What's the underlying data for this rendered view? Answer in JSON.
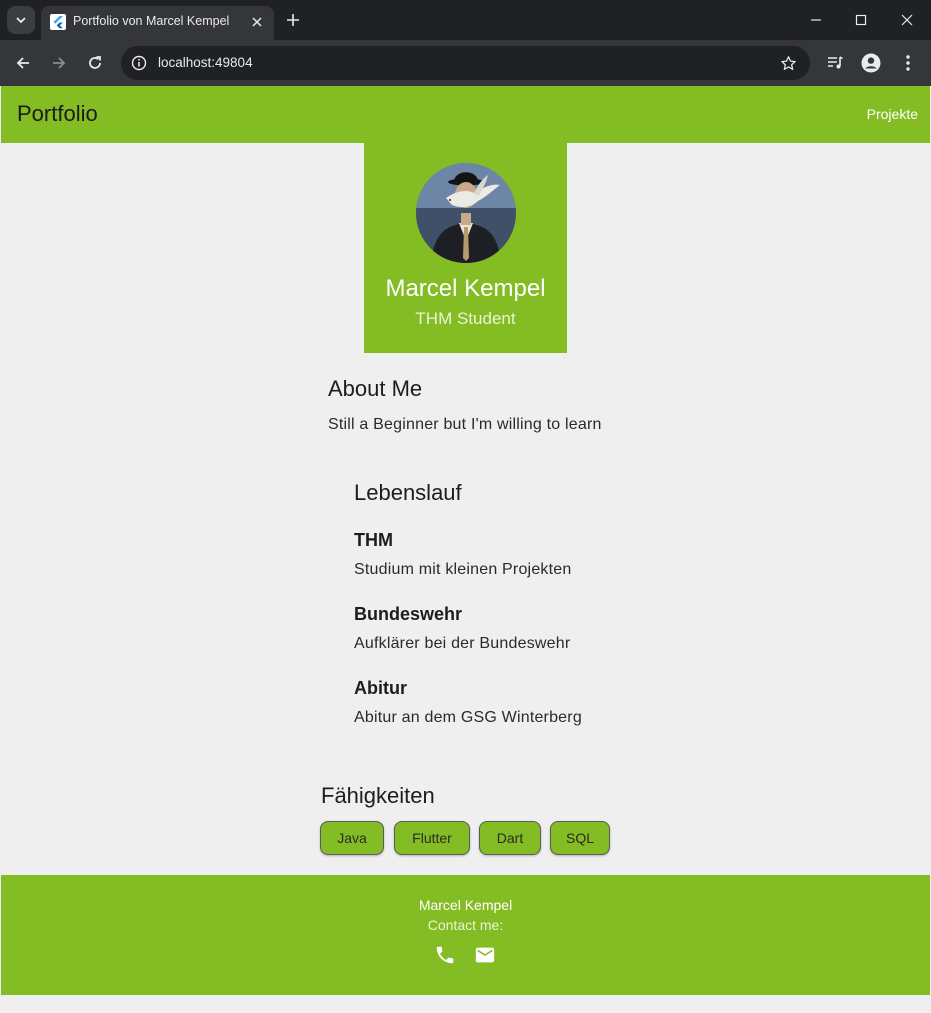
{
  "browser": {
    "tab_title": "Portfolio von Marcel Kempel",
    "url": "localhost:49804"
  },
  "appbar": {
    "title": "Portfolio",
    "nav_link": "Projekte"
  },
  "hero": {
    "name": "Marcel Kempel",
    "subtitle": "THM Student"
  },
  "about": {
    "title": "About Me",
    "text": "Still a Beginner but I'm willing to learn"
  },
  "cv": {
    "title": "Lebenslauf",
    "items": [
      {
        "title": "THM",
        "text": "Studium mit kleinen Projekten"
      },
      {
        "title": "Bundeswehr",
        "text": "Aufklärer bei der Bundeswehr"
      },
      {
        "title": "Abitur",
        "text": "Abitur an dem GSG Winterberg"
      }
    ]
  },
  "skills": {
    "title": "Fähigkeiten",
    "items": [
      "Java",
      "Flutter",
      "Dart",
      "SQL"
    ]
  },
  "footer": {
    "name": "Marcel Kempel",
    "contact_label": "Contact me:"
  },
  "colors": {
    "accent": "#84bc23",
    "page_background": "#efefef",
    "browser_frame": "#202124",
    "browser_toolbar": "#35363a"
  },
  "icons": [
    "tab-search-icon",
    "flutter-favicon",
    "close-icon",
    "plus-icon",
    "minimize-icon",
    "maximize-icon",
    "window-close-icon",
    "back-arrow-icon",
    "forward-arrow-icon",
    "reload-icon",
    "site-info-icon",
    "star-icon",
    "media-icon",
    "profile-icon",
    "more-vert-icon",
    "phone-icon",
    "email-icon"
  ]
}
